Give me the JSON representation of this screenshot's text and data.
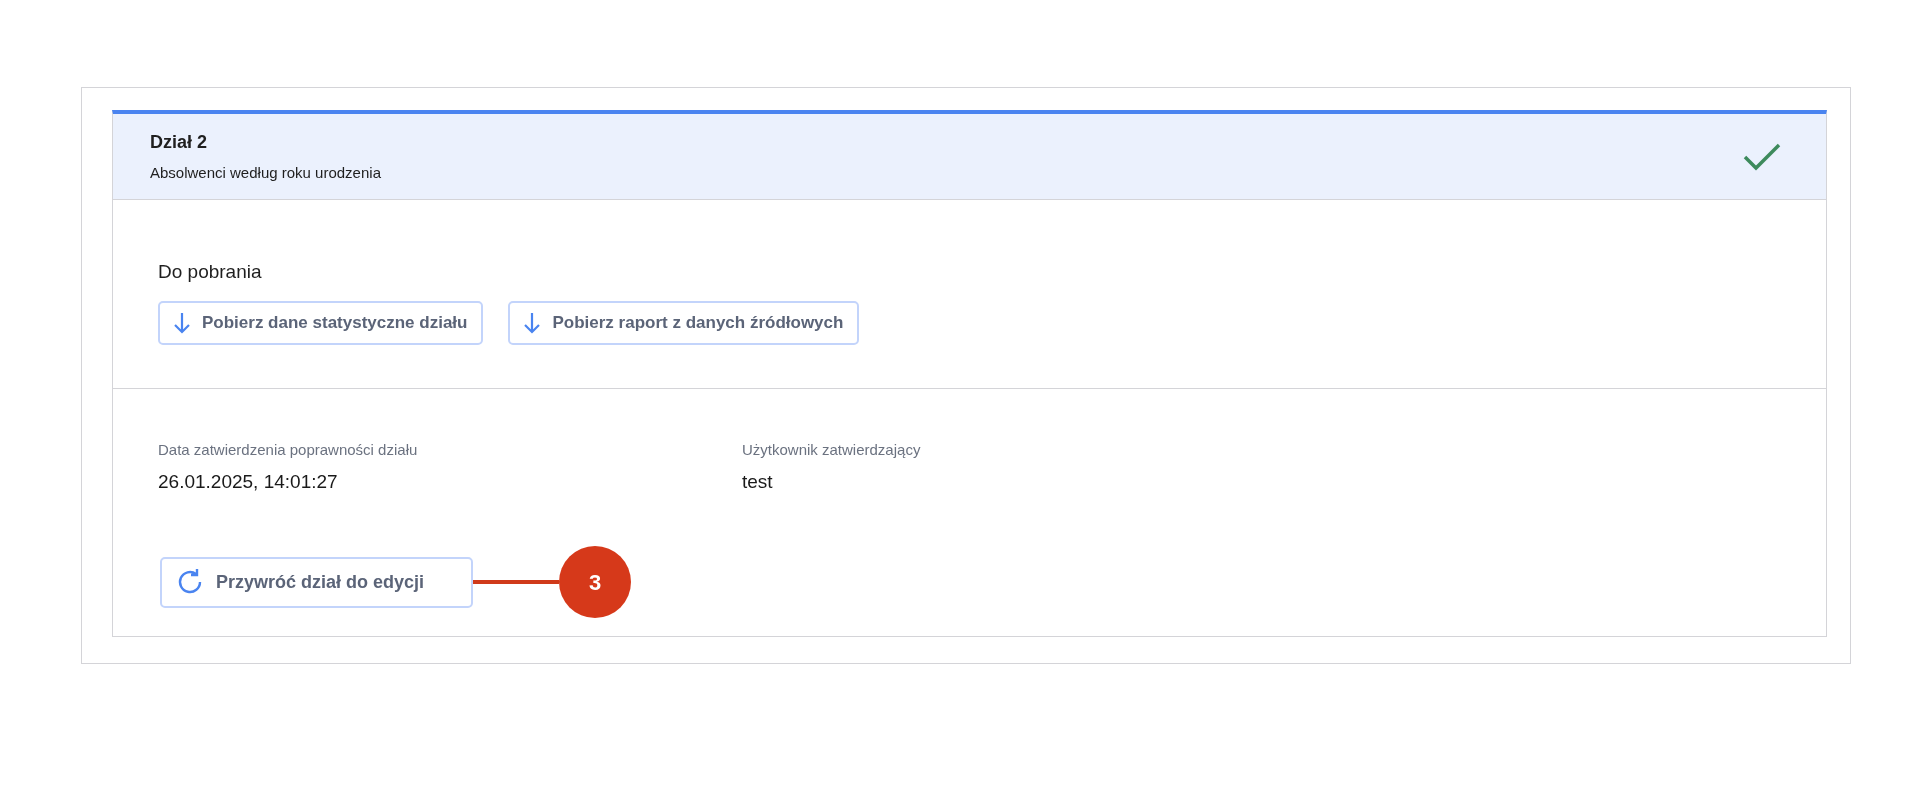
{
  "section": {
    "title": "Dział 2",
    "subtitle": "Absolwenci według roku urodzenia",
    "completed": true
  },
  "downloads": {
    "label": "Do pobrania",
    "buttons": [
      "Pobierz dane statystyczne działu",
      "Pobierz raport z danych źródłowych"
    ]
  },
  "fields": [
    {
      "label": "Data zatwierdzenia poprawności działu",
      "value": "26.01.2025, 14:01:27"
    },
    {
      "label": "Użytkownik zatwierdzający",
      "value": "test"
    }
  ],
  "restore_button": "Przywróć dział do edycji",
  "callout": "3"
}
